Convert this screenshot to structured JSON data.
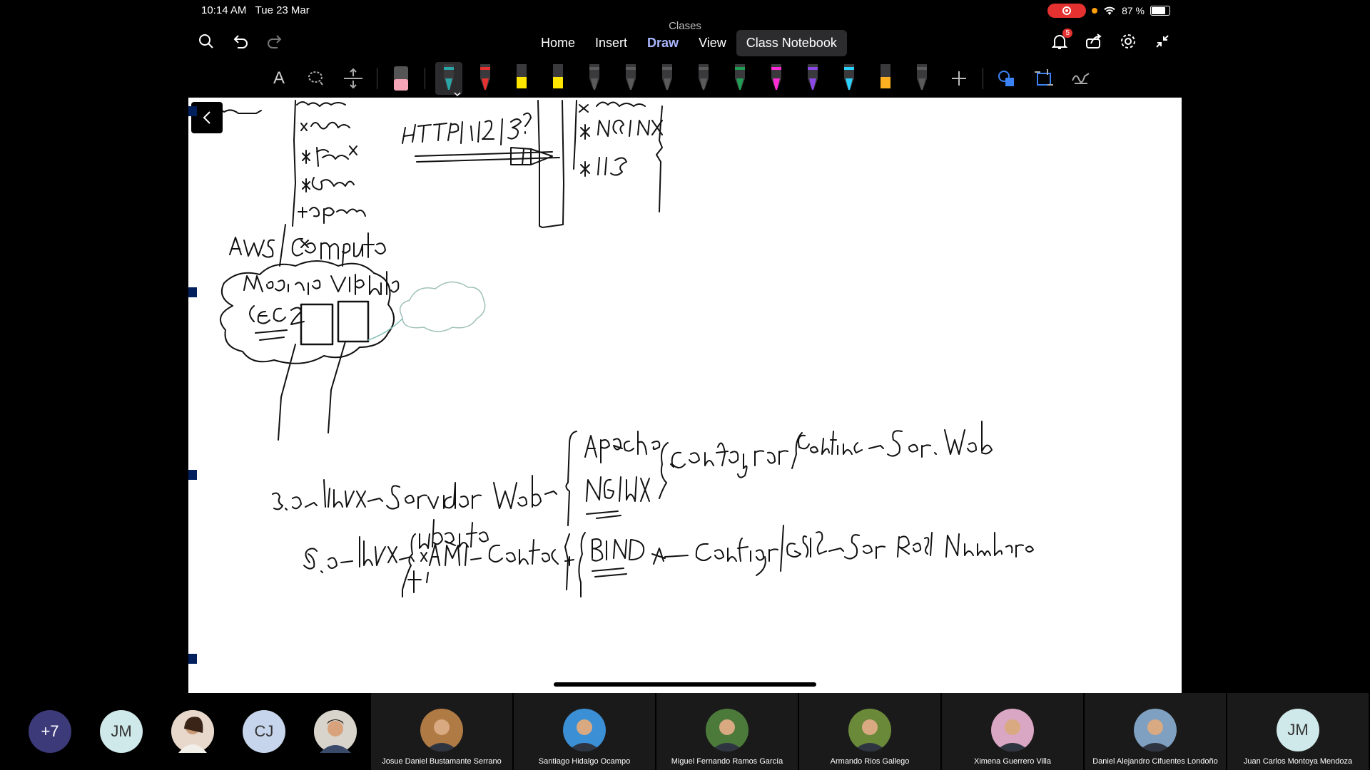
{
  "status": {
    "time": "10:14 AM",
    "date": "Tue 23 Mar",
    "battery": "87 %",
    "battery_level": 0.87
  },
  "app": {
    "doc_title": "Clases"
  },
  "tabs": [
    {
      "label": "Home",
      "active": false
    },
    {
      "label": "Insert",
      "active": false
    },
    {
      "label": "Draw",
      "active": true
    },
    {
      "label": "View",
      "active": false
    },
    {
      "label": "Class Notebook",
      "active": false
    }
  ],
  "notifications": {
    "count": "5"
  },
  "toolbar": {
    "pens": [
      {
        "name": "pen-teal",
        "color": "#2aa6a6",
        "selected": true
      },
      {
        "name": "pen-red",
        "color": "#e5312f"
      },
      {
        "name": "highlighter-yellow",
        "color": "#ffe600"
      },
      {
        "name": "highlighter-yellow-2",
        "color": "#ffe600"
      },
      {
        "name": "pen-gray-1",
        "color": "#5a5a5a"
      },
      {
        "name": "pen-gray-2",
        "color": "#5a5a5a"
      },
      {
        "name": "pen-gray-3",
        "color": "#5a5a5a"
      },
      {
        "name": "pen-gray-4",
        "color": "#5a5a5a"
      },
      {
        "name": "pen-green",
        "color": "#1f9d55"
      },
      {
        "name": "pen-magenta",
        "color": "#ff2bd6"
      },
      {
        "name": "pen-purple",
        "color": "#8a48e6"
      },
      {
        "name": "pen-cyan",
        "color": "#2bd2ff"
      },
      {
        "name": "highlighter-orange",
        "color": "#ffb020"
      },
      {
        "name": "pen-gray-5",
        "color": "#5a5a5a"
      }
    ]
  },
  "participants": {
    "overflow": "+7",
    "avatars": [
      {
        "initials": "JM",
        "bg": "#cfe8ea",
        "fg": "#333"
      },
      {
        "initials": "",
        "bg": "#c9a27e",
        "fg": "#fff"
      },
      {
        "initials": "CJ",
        "bg": "#c7d5ec",
        "fg": "#333"
      },
      {
        "initials": "",
        "bg": "#8a7a6a",
        "fg": "#fff"
      }
    ],
    "tiles": [
      {
        "name": "Josue Daniel Bustamante Serrano",
        "color": "#b07a45"
      },
      {
        "name": "Santiago Hidalgo Ocampo",
        "color": "#3b8fd4"
      },
      {
        "name": "Miguel Fernando Ramos García",
        "color": "#4c7a3a"
      },
      {
        "name": "Armando Rios Gallego",
        "color": "#6a8a3a"
      },
      {
        "name": "Ximena Guerrero Villa",
        "color": "#d9a6c4"
      },
      {
        "name": "Daniel Alejandro Cifuentes Londoño",
        "color": "#7fa0c0"
      },
      {
        "name": "Juan Carlos Montoya Mendoza",
        "color": "#cfe8ea",
        "initials": "JM"
      }
    ]
  }
}
